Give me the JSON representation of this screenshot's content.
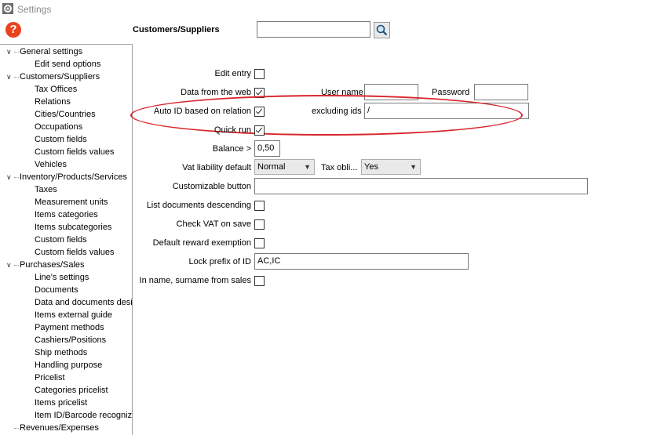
{
  "window": {
    "title": "Settings"
  },
  "help": {
    "glyph": "?"
  },
  "header": {
    "section_title": "Customers/Suppliers",
    "search_value": ""
  },
  "tree": [
    {
      "label": "General settings",
      "level": 0,
      "expandable": true
    },
    {
      "label": "Edit send options",
      "level": 1
    },
    {
      "label": "Customers/Suppliers",
      "level": 0,
      "expandable": true
    },
    {
      "label": "Tax Offices",
      "level": 1
    },
    {
      "label": "Relations",
      "level": 1
    },
    {
      "label": "Cities/Countries",
      "level": 1
    },
    {
      "label": "Occupations",
      "level": 1
    },
    {
      "label": "Custom fields",
      "level": 1
    },
    {
      "label": "Custom fields values",
      "level": 1
    },
    {
      "label": "Vehicles",
      "level": 1
    },
    {
      "label": "Inventory/Products/Services",
      "level": 0,
      "expandable": true
    },
    {
      "label": "Taxes",
      "level": 1
    },
    {
      "label": "Measurement units",
      "level": 1
    },
    {
      "label": "Items categories",
      "level": 1
    },
    {
      "label": "Items subcategories",
      "level": 1
    },
    {
      "label": "Custom fields",
      "level": 1
    },
    {
      "label": "Custom fields values",
      "level": 1
    },
    {
      "label": "Purchases/Sales",
      "level": 0,
      "expandable": true
    },
    {
      "label": "Line's settings",
      "level": 1
    },
    {
      "label": "Documents",
      "level": 1
    },
    {
      "label": "Data and documents desi",
      "level": 1
    },
    {
      "label": "Items external guide",
      "level": 1
    },
    {
      "label": "Payment methods",
      "level": 1
    },
    {
      "label": "Cashiers/Positions",
      "level": 1
    },
    {
      "label": "Ship methods",
      "level": 1
    },
    {
      "label": "Handling purpose",
      "level": 1
    },
    {
      "label": "Pricelist",
      "level": 1
    },
    {
      "label": "Categories pricelist",
      "level": 1
    },
    {
      "label": "Items pricelist",
      "level": 1
    },
    {
      "label": "Item ID/Barcode recognize",
      "level": 1
    },
    {
      "label": "Revenues/Expenses",
      "level": 0,
      "expandable": false
    }
  ],
  "form": {
    "edit_entry": {
      "label": "Edit entry",
      "checked": false
    },
    "data_from_web": {
      "label": "Data from the web",
      "checked": true
    },
    "user_name": {
      "label": "User name",
      "value": ""
    },
    "password": {
      "label": "Password",
      "value": ""
    },
    "auto_id": {
      "label": "Auto ID based on relation",
      "checked": true
    },
    "excluding_ids": {
      "label": "excluding ids",
      "value": "/"
    },
    "quick_run": {
      "label": "Quick run",
      "checked": true
    },
    "balance": {
      "label": "Balance >",
      "value": "0,50"
    },
    "vat_liability": {
      "label": "Vat liability default",
      "value": "Normal"
    },
    "tax_obligation": {
      "label": "Tax obli...",
      "value": "Yes"
    },
    "customizable_button": {
      "label": "Customizable button",
      "value": ""
    },
    "list_docs_desc": {
      "label": "List documents descending",
      "checked": false
    },
    "check_vat": {
      "label": "Check VAT on save",
      "checked": false
    },
    "default_reward": {
      "label": "Default reward exemption",
      "checked": false
    },
    "lock_prefix": {
      "label": "Lock prefix of ID",
      "value": "AC,IC"
    },
    "name_surname": {
      "label": "In name, surname from sales",
      "checked": false
    }
  },
  "colors": {
    "highlight_ellipse": "#d9262d",
    "help_icon": "#e8431e"
  }
}
